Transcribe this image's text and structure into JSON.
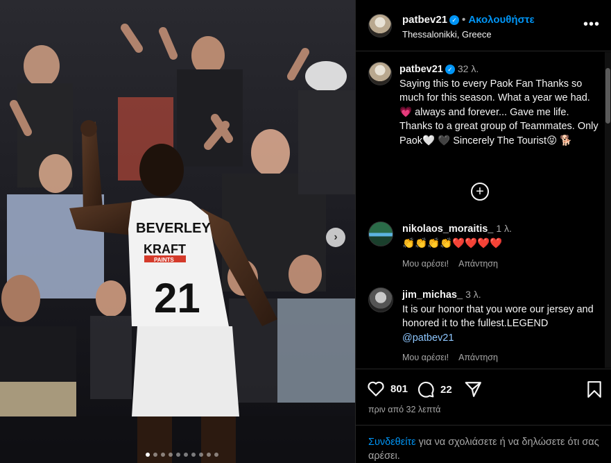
{
  "post": {
    "username": "patbev21",
    "follow_label": "Ακολουθήστε",
    "location": "Thessalonikki, Greece",
    "more_label": "•••"
  },
  "caption": {
    "username": "patbev21",
    "time": "32 λ.",
    "text": "Saying this to every Paok Fan Thanks so much for this season. What a year we had. 💗 always and forever... Gave me life. Thanks to a great group of Teammates.  Only Paok🤍 🖤 Sincerely The Tourist😝 🐕"
  },
  "comments": [
    {
      "username": "nikolaos_moraitis_",
      "time": "1 λ.",
      "text": "👏👏👏👏❤️❤️❤️❤️",
      "like_label": "Μου αρέσει!",
      "reply_label": "Απάντηση"
    },
    {
      "username": "jim_michas_",
      "time": "3 λ.",
      "text": "It is our honor that you wore our jersey and honored it to the fullest.LEGEND",
      "mention": "@patbev21",
      "like_label": "Μου αρέσει!",
      "reply_label": "Απάντηση"
    }
  ],
  "actions": {
    "likes": "801",
    "comments": "22",
    "posted": "πριν από 32 λεπτά"
  },
  "login": {
    "link": "Συνδεθείτε",
    "text": " για να σχολιάσετε ή να δηλώσετε ότι σας αρέσει."
  },
  "photo": {
    "jersey_name": "BEVERLEY",
    "jersey_number": "21",
    "sponsor": "KRAFT",
    "sponsor_sub": "PAINTS"
  },
  "colors": {
    "accent": "#0095f6",
    "background": "#000000",
    "muted": "#a8a8a8"
  }
}
